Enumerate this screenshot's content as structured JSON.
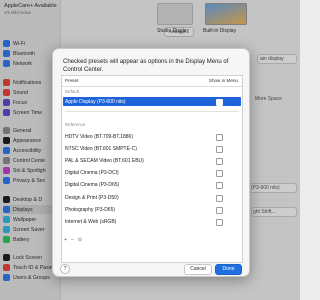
{
  "account": {
    "name": "AppleCare+ Available",
    "sub": "4/5 Mild Indian"
  },
  "sidebar": {
    "items": [
      {
        "label": "Wi-Fi",
        "icon": "wifi-icon",
        "color": "#2f7bf5"
      },
      {
        "label": "Bluetooth",
        "icon": "bluetooth-icon",
        "color": "#2f7bf5"
      },
      {
        "label": "Network",
        "icon": "network-icon",
        "color": "#2f7bf5"
      },
      {
        "label": "Notifications",
        "icon": "bell-icon",
        "color": "#e8473b"
      },
      {
        "label": "Sound",
        "icon": "speaker-icon",
        "color": "#e8473b"
      },
      {
        "label": "Focus",
        "icon": "moon-icon",
        "color": "#5b4fd1"
      },
      {
        "label": "Screen Time",
        "icon": "hourglass-icon",
        "color": "#5b4fd1"
      },
      {
        "label": "General",
        "icon": "gear-icon",
        "color": "#8e8e93"
      },
      {
        "label": "Appearance",
        "icon": "appearance-icon",
        "color": "#222222"
      },
      {
        "label": "Accessibility",
        "icon": "accessibility-icon",
        "color": "#2f7bf5"
      },
      {
        "label": "Control Cente",
        "icon": "control-center-icon",
        "color": "#8e8e93"
      },
      {
        "label": "Siri & Spotligh",
        "icon": "siri-icon",
        "color": "#c640d6"
      },
      {
        "label": "Privacy & Sec",
        "icon": "hand-icon",
        "color": "#2f7bf5"
      },
      {
        "label": "Desktop & D",
        "icon": "desktop-icon",
        "color": "#222222"
      },
      {
        "label": "Displays",
        "icon": "display-icon",
        "color": "#2f7bf5"
      },
      {
        "label": "Wallpaper",
        "icon": "wallpaper-icon",
        "color": "#38b8e8"
      },
      {
        "label": "Screen Saver",
        "icon": "screensaver-icon",
        "color": "#38b8e8"
      },
      {
        "label": "Battery",
        "icon": "battery-icon",
        "color": "#34c759"
      },
      {
        "label": "Lock Screen",
        "icon": "lock-icon",
        "color": "#222222"
      },
      {
        "label": "Touch ID & Password",
        "icon": "fingerprint-icon",
        "color": "#e8473b"
      },
      {
        "label": "Users & Groups",
        "icon": "users-icon",
        "color": "#2f7bf5"
      }
    ]
  },
  "main": {
    "arrange_label": "Arrange...",
    "monitor_studio": "Studio Display",
    "monitor_builtin": "Built-in Display",
    "right_texts": [
      "ain display",
      "More Space",
      "(P3-600 nits)",
      "ght Shift..."
    ]
  },
  "sheet": {
    "title": "Checked presets will appear as options in the Display Menu of Control Center.",
    "col_preset": "Preset",
    "col_show": "Show in Menu",
    "group_default": "Default",
    "group_reference": "Reference",
    "default_rows": [
      {
        "label": "Apple Display (P3-600 nits)",
        "checked": false
      }
    ],
    "reference_rows": [
      {
        "label": "HDTV Video (BT.709-BT.1886)",
        "checked": false
      },
      {
        "label": "NTSC Video (BT.601 SMPTE-C)",
        "checked": false
      },
      {
        "label": "PAL & SECAM Video (BT.601 EBU)",
        "checked": false
      },
      {
        "label": "Digital Cinema (P3-DCI)",
        "checked": false
      },
      {
        "label": "Digital Cinema (P3-D65)",
        "checked": false
      },
      {
        "label": "Design & Print (P3-D50)",
        "checked": false
      },
      {
        "label": "Photography (P3-D65)",
        "checked": false
      },
      {
        "label": "Internet & Web (sRGB)",
        "checked": false
      }
    ],
    "tools": {
      "add": "+",
      "remove": "−",
      "more": "⊙"
    },
    "help_label": "?",
    "cancel_label": "Cancel",
    "done_label": "Done",
    "colors": {
      "accent": "#1f6fe0",
      "selection": "#1f63d8"
    }
  }
}
